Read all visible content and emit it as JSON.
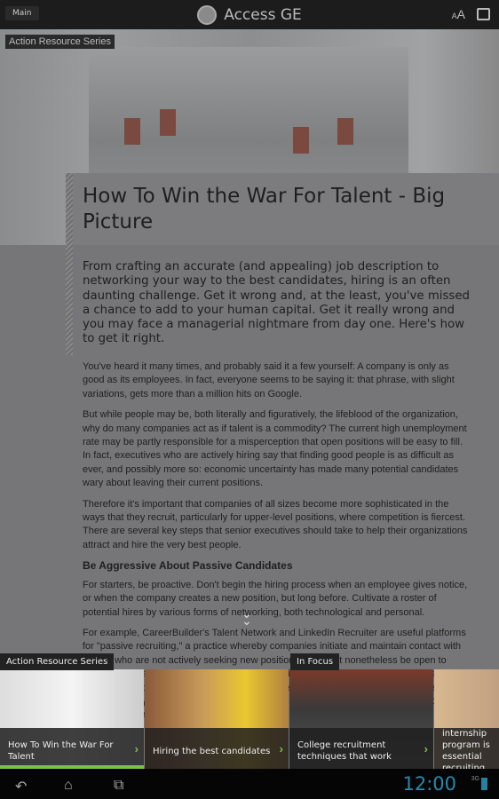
{
  "topbar": {
    "main_label": "Main",
    "logo_text": "GE",
    "title": "Access GE",
    "font_size_small": "A",
    "font_size_large": "A",
    "share_icon": "share-icon"
  },
  "hero": {
    "series_tag": "Action Resource Series"
  },
  "article": {
    "title": "How To Win the War For Talent - Big Picture",
    "intro": "From crafting an accurate (and appealing) job description to networking your way to the best candidates, hiring is an often daunting challenge. Get it wrong and, at the least, you've missed a chance to add to your human capital. Get it really wrong and you may face a managerial nightmare from day one. Here's how to get it right.",
    "paragraphs": [
      "You've heard it many times, and probably said it a few yourself: A company is only as good as its employees. In fact, everyone seems to be saying it: that phrase, with slight variations, gets more than a million hits on Google.",
      "But while people may be, both literally and figuratively, the lifeblood of the organization, why do many companies act as if talent is a commodity? The current high unemployment rate may be partly responsible for a misperception that open positions will be easy to fill. In fact, executives who are actively hiring say that finding good people is as difficult as ever, and possibly more so: economic uncertainty has made many potential candidates wary about leaving their current positions.",
      "Therefore it's important that companies of all sizes become more sophisticated in the ways that they recruit, particularly for upper-level positions, where competition is fiercest. There are several key steps that senior executives should take to help their organizations attract and hire the very best people."
    ],
    "subheading": "Be Aggressive About Passive Candidates",
    "paragraphs2": [
      "For starters, be proactive. Don't begin the hiring process when an employee gives notice, or when the company creates a new position, but long before. Cultivate a roster of potential hires by various forms of networking, both technological and personal.",
      "For example, CareerBuilder's Talent Network and LinkedIn Recruiter are useful platforms for \"passive recruiting,\" a practice whereby companies initiate and maintain contact with people who are not actively seeking new positions but might nonetheless be open to talking. (Both services are also useful for matching active job seekers to open positions.) Passive, or \"continuous,\" recruiting can be a great way to vet promising candidates over a period of many weeks or months. For fast-growing companies it can serve to build a pipeline of talent that can be hired"
    ]
  },
  "carousel": {
    "sections": [
      "Action Resource Series",
      "In Focus"
    ],
    "cards": [
      {
        "caption": "How To Win the War For Talent"
      },
      {
        "caption": "Hiring the best candidates"
      },
      {
        "caption": "College recruitment techniques that work"
      },
      {
        "caption": "Why GE's internship program is essential recruiting strategy"
      }
    ]
  },
  "statusbar": {
    "time": "12:00",
    "signal": "3G"
  },
  "colors": {
    "accent_green": "#7cc04a",
    "clock_blue": "#33b5e5"
  }
}
